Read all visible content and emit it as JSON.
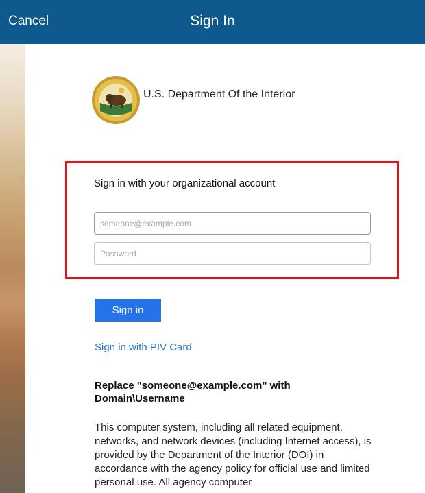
{
  "navbar": {
    "cancel_label": "Cancel",
    "title": "Sign In",
    "background": "#0e5a8e"
  },
  "organization": {
    "name": "U.S. Department Of the Interior",
    "logo_icon": "doi-bison-seal-icon"
  },
  "signin_form": {
    "prompt": "Sign in with your organizational account",
    "email_placeholder": "someone@example.com",
    "email_value": "",
    "password_placeholder": "Password",
    "password_value": "",
    "highlight_color": "#e0121a"
  },
  "actions": {
    "signin_label": "Sign in",
    "signin_color": "#2672e8",
    "piv_link": "Sign in with PIV Card"
  },
  "notice": {
    "heading": "Replace \"someone@example.com\" with Domain\\Username",
    "body": "This computer system, including all related equipment, networks, and network devices (including Internet access), is provided by the Department of the Interior (DOI) in accordance with the agency policy for official use and limited personal use. All agency computer"
  }
}
